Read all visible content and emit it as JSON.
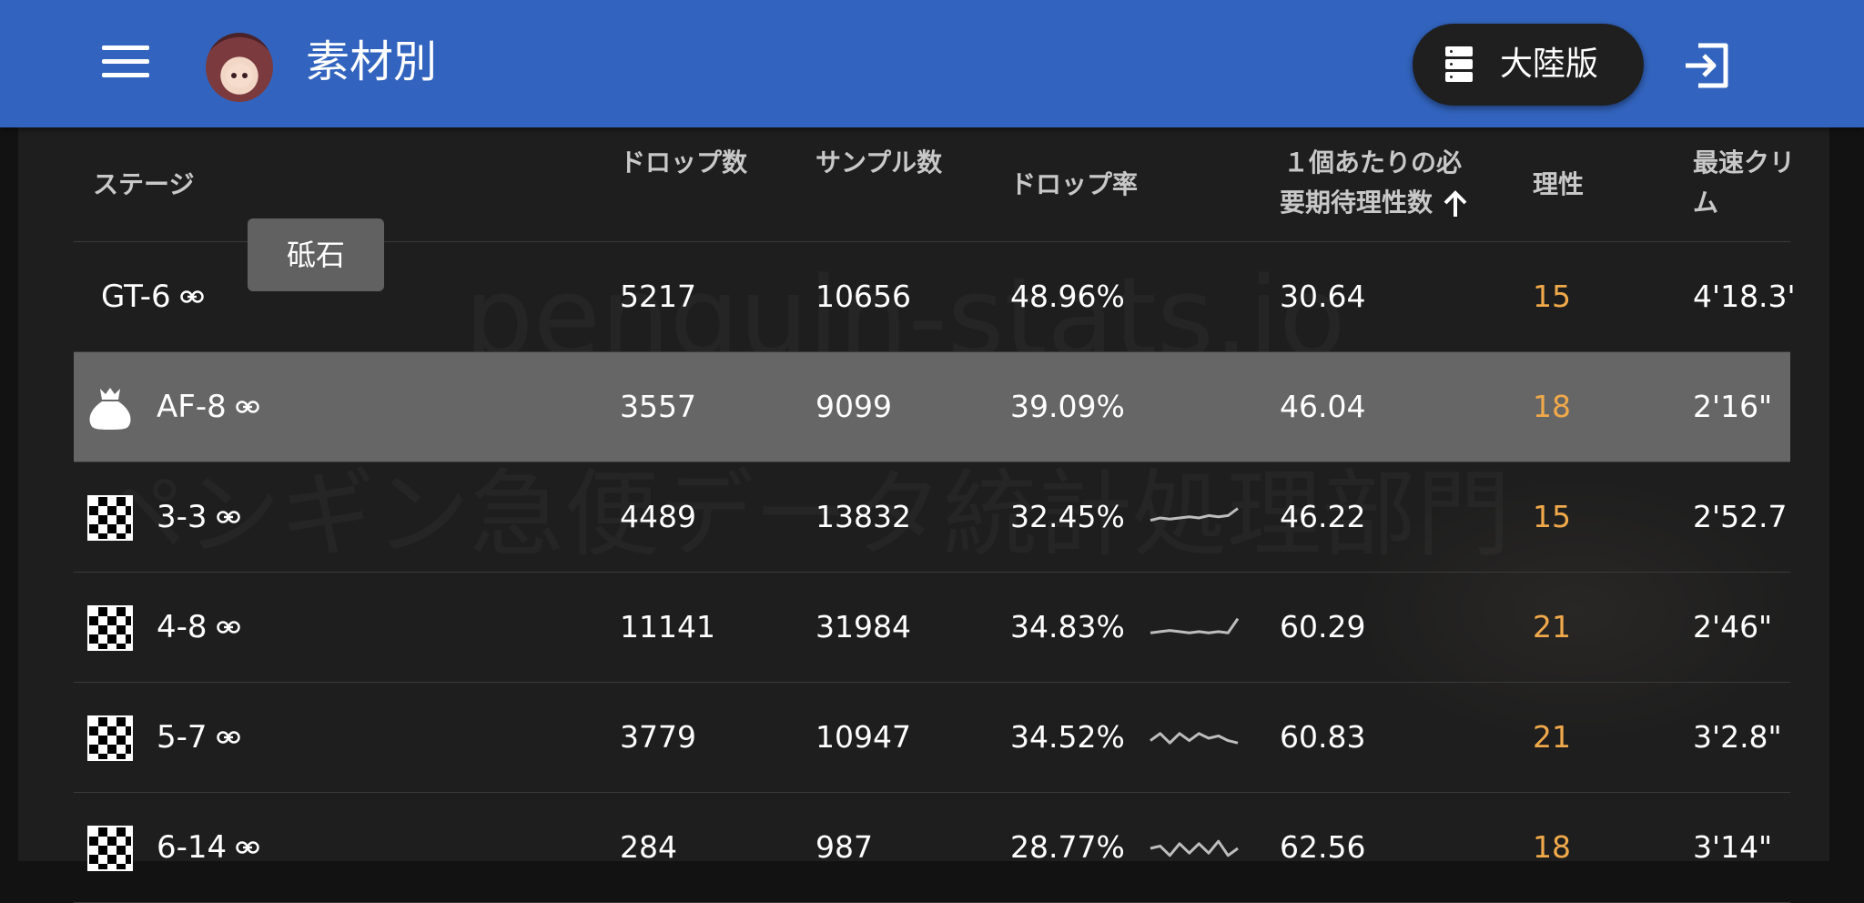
{
  "appbar": {
    "title": "素材別",
    "server_label": "大陸版"
  },
  "watermark": {
    "line1": "penguin-stats.io",
    "line2": "ペンギン急便データ統計処理部門"
  },
  "tooltip": "砥石",
  "table": {
    "headers": {
      "stage": "ステージ",
      "drops": "ドロップ数",
      "samples": "サンプル数",
      "rate": "ドロップ率",
      "cost_line1": "１個あたりの必",
      "cost_line2": "要期待理性数",
      "ap": "理性",
      "fastest_line1": "最速クリ",
      "fastest_line2": "ム"
    },
    "rows": [
      {
        "stage": "GT-6",
        "drops": "5217",
        "samples": "10656",
        "rate": "48.96%",
        "cost": "30.64",
        "ap": "15",
        "fastest": "4'18.3\"",
        "icon": "none",
        "highlight": false,
        "sparkline": null
      },
      {
        "stage": "AF-8",
        "drops": "3557",
        "samples": "9099",
        "rate": "39.09%",
        "cost": "46.04",
        "ap": "18",
        "fastest": "2'16\"",
        "icon": "money-bag-icon",
        "highlight": true,
        "sparkline": null
      },
      {
        "stage": "3-3",
        "drops": "4489",
        "samples": "13832",
        "rate": "32.45%",
        "cost": "46.22",
        "ap": "15",
        "fastest": "2'52.7",
        "icon": "checker-icon",
        "highlight": false,
        "sparkline": [
          0.4,
          0.5,
          0.45,
          0.5,
          0.55,
          0.5,
          0.6,
          0.55,
          0.6,
          0.9
        ]
      },
      {
        "stage": "4-8",
        "drops": "11141",
        "samples": "31984",
        "rate": "34.83%",
        "cost": "60.29",
        "ap": "21",
        "fastest": "2'46\"",
        "icon": "checker-icon",
        "highlight": false,
        "sparkline": [
          0.3,
          0.35,
          0.4,
          0.35,
          0.3,
          0.35,
          0.3,
          0.35,
          0.3,
          0.9
        ]
      },
      {
        "stage": "5-7",
        "drops": "3779",
        "samples": "10947",
        "rate": "34.52%",
        "cost": "60.83",
        "ap": "21",
        "fastest": "3'2.8\"",
        "icon": "checker-icon",
        "highlight": false,
        "sparkline": [
          0.4,
          0.7,
          0.3,
          0.7,
          0.4,
          0.7,
          0.5,
          0.6,
          0.4,
          0.3
        ]
      },
      {
        "stage": "6-14",
        "drops": "284",
        "samples": "987",
        "rate": "28.77%",
        "cost": "62.56",
        "ap": "18",
        "fastest": "3'14\"",
        "icon": "checker-icon",
        "highlight": false,
        "sparkline": [
          0.5,
          0.6,
          0.2,
          0.7,
          0.3,
          0.7,
          0.3,
          0.8,
          0.2,
          0.5
        ]
      }
    ]
  }
}
